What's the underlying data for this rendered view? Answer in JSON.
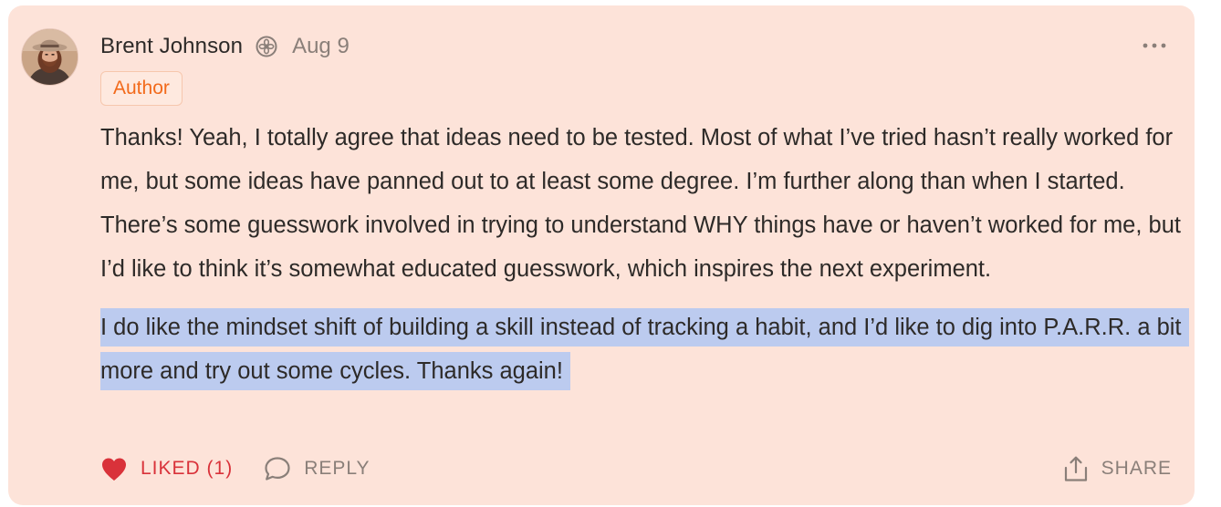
{
  "comment": {
    "author": {
      "name": "Brent Johnson",
      "avatar_icon": "avatar-photo"
    },
    "date": "Aug 9",
    "badge_icon": "founding-member-badge-icon",
    "tag_label": "Author",
    "paragraphs": [
      "Thanks! Yeah, I totally agree that ideas need to be tested. Most of what I’ve tried hasn’t really worked for me, but some ideas have panned out to at least some degree. I’m further along than when I started. There’s some guesswork involved in trying to understand WHY things have or haven’t worked for me, but I’d like to think it’s somewhat educated guesswork, which inspires the next experiment.",
      "I do like the mindset shift of building a skill instead of tracking a habit, and I’d like to dig into P.A.R.R. a bit more and try out some cycles. Thanks again!"
    ],
    "more_icon": "more-horizontal-icon"
  },
  "actions": {
    "like_label": "LIKED (1)",
    "reply_label": "REPLY",
    "share_label": "SHARE"
  },
  "colors": {
    "card_background": "#fde3d9",
    "selection_highlight": "#bccbef",
    "tag_text": "#f26a1b",
    "liked": "#d9323a",
    "muted": "#8a7f79",
    "text": "#2d2a28"
  }
}
